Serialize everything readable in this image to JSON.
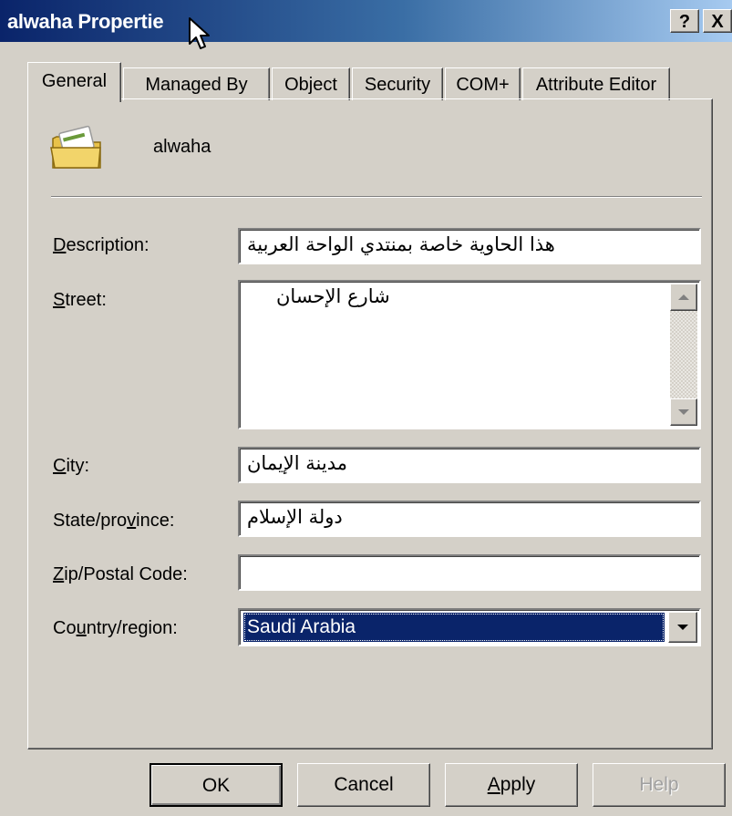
{
  "window": {
    "title": "alwaha Propertie",
    "help_button": "?",
    "close_button": "X"
  },
  "tabs": [
    {
      "label": "General",
      "active": true
    },
    {
      "label": "Managed By",
      "active": false
    },
    {
      "label": "Object",
      "active": false
    },
    {
      "label": "Security",
      "active": false
    },
    {
      "label": "COM+",
      "active": false
    },
    {
      "label": "Attribute Editor",
      "active": false
    }
  ],
  "object": {
    "name": "alwaha",
    "icon": "folder-icon"
  },
  "form": {
    "description": {
      "label_first": "D",
      "label_rest": "escription:",
      "value": "هذا الحاوية خاصة بمنتدي الواحة العربية"
    },
    "street": {
      "label_first": "S",
      "label_rest": "treet:",
      "value": "شارع الإحسان"
    },
    "city": {
      "label_first": "C",
      "label_rest": "ity:",
      "value": "مدينة الإيمان"
    },
    "state": {
      "label_before": "State/pro",
      "label_mnemonic": "v",
      "label_after": "ince:",
      "value": "دولة الإسلام"
    },
    "zip": {
      "label_first": "Z",
      "label_rest": "ip/Postal Code:",
      "value": ""
    },
    "country": {
      "label_before": "Co",
      "label_mnemonic": "u",
      "label_after": "ntry/region:",
      "value": "Saudi Arabia"
    }
  },
  "buttons": {
    "ok": "OK",
    "cancel": "Cancel",
    "apply_first": "A",
    "apply_rest": "pply",
    "help": "Help"
  },
  "colors": {
    "dialog_bg": "#d4d0c8",
    "title_start": "#0a246a",
    "title_end": "#a6caf0",
    "selection": "#0a246a"
  }
}
